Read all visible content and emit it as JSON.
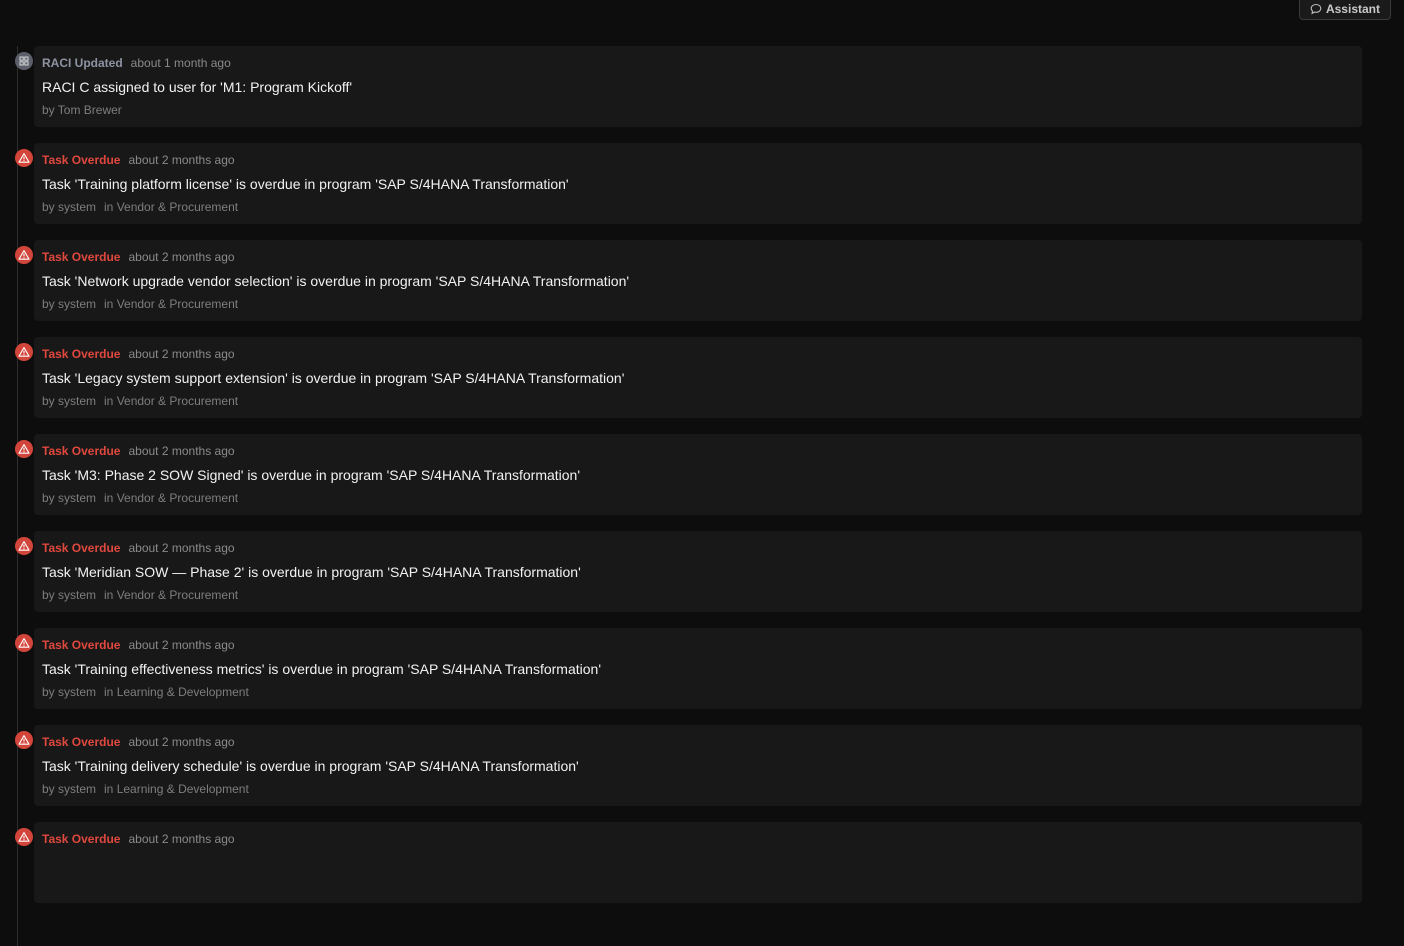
{
  "header": {
    "assistant_label": "Assistant"
  },
  "colors": {
    "background": "#0d0d0d",
    "card": "#181818",
    "overdue": "#e0483e",
    "raci": "#8e93a1"
  },
  "events": [
    {
      "kind": "raci",
      "icon": "raci-icon",
      "type": "RACI Updated",
      "time": "about 1 month ago",
      "message": "RACI C assigned to user for 'M1: Program Kickoff'",
      "by": "by Tom Brewer",
      "context": ""
    },
    {
      "kind": "overdue",
      "icon": "warning-icon",
      "type": "Task Overdue",
      "time": "about 2 months ago",
      "message": "Task 'Training platform license' is overdue in program 'SAP S/4HANA Transformation'",
      "by": "by system",
      "context": "in Vendor & Procurement"
    },
    {
      "kind": "overdue",
      "icon": "warning-icon",
      "type": "Task Overdue",
      "time": "about 2 months ago",
      "message": "Task 'Network upgrade vendor selection' is overdue in program 'SAP S/4HANA Transformation'",
      "by": "by system",
      "context": "in Vendor & Procurement"
    },
    {
      "kind": "overdue",
      "icon": "warning-icon",
      "type": "Task Overdue",
      "time": "about 2 months ago",
      "message": "Task 'Legacy system support extension' is overdue in program 'SAP S/4HANA Transformation'",
      "by": "by system",
      "context": "in Vendor & Procurement"
    },
    {
      "kind": "overdue",
      "icon": "warning-icon",
      "type": "Task Overdue",
      "time": "about 2 months ago",
      "message": "Task 'M3: Phase 2 SOW Signed' is overdue in program 'SAP S/4HANA Transformation'",
      "by": "by system",
      "context": "in Vendor & Procurement"
    },
    {
      "kind": "overdue",
      "icon": "warning-icon",
      "type": "Task Overdue",
      "time": "about 2 months ago",
      "message": "Task 'Meridian SOW — Phase 2' is overdue in program 'SAP S/4HANA Transformation'",
      "by": "by system",
      "context": "in Vendor & Procurement"
    },
    {
      "kind": "overdue",
      "icon": "warning-icon",
      "type": "Task Overdue",
      "time": "about 2 months ago",
      "message": "Task 'Training effectiveness metrics' is overdue in program 'SAP S/4HANA Transformation'",
      "by": "by system",
      "context": "in Learning & Development"
    },
    {
      "kind": "overdue",
      "icon": "warning-icon",
      "type": "Task Overdue",
      "time": "about 2 months ago",
      "message": "Task 'Training delivery schedule' is overdue in program 'SAP S/4HANA Transformation'",
      "by": "by system",
      "context": "in Learning & Development"
    },
    {
      "kind": "overdue",
      "icon": "warning-icon",
      "type": "Task Overdue",
      "time": "about 2 months ago",
      "message": "",
      "by": "",
      "context": ""
    }
  ]
}
